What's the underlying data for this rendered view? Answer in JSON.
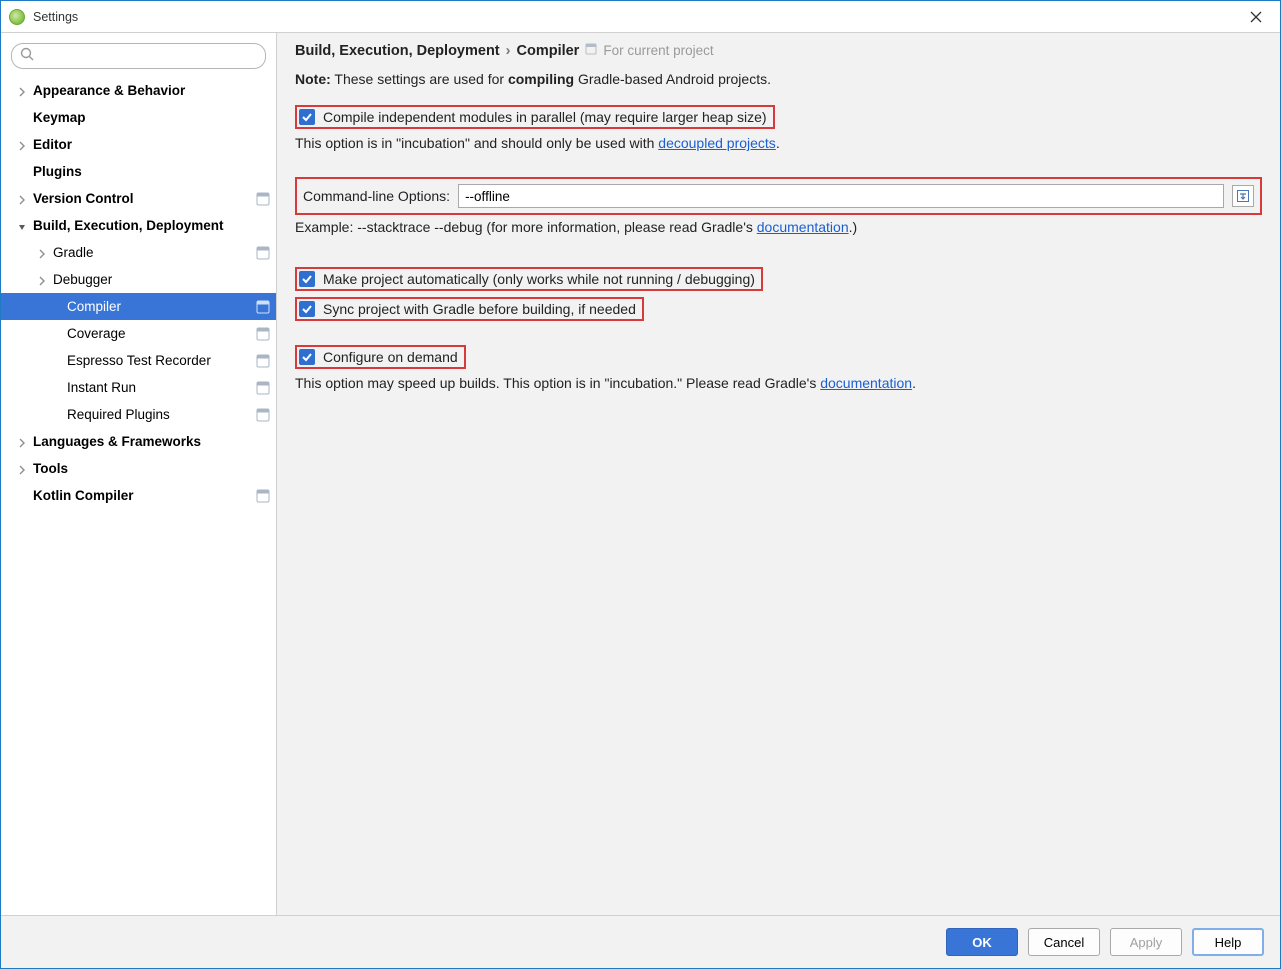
{
  "window": {
    "title": "Settings"
  },
  "sidebar": {
    "search_placeholder": "",
    "items": [
      {
        "label": "Appearance & Behavior",
        "depth": 0,
        "bold": true,
        "expander": "closed"
      },
      {
        "label": "Keymap",
        "depth": 0,
        "bold": true
      },
      {
        "label": "Editor",
        "depth": 0,
        "bold": true,
        "expander": "closed"
      },
      {
        "label": "Plugins",
        "depth": 0,
        "bold": true
      },
      {
        "label": "Version Control",
        "depth": 0,
        "bold": true,
        "expander": "closed",
        "badge": true
      },
      {
        "label": "Build, Execution, Deployment",
        "depth": 0,
        "bold": true,
        "expander": "open"
      },
      {
        "label": "Gradle",
        "depth": 1,
        "expander": "closed",
        "badge": true
      },
      {
        "label": "Debugger",
        "depth": 1,
        "expander": "closed"
      },
      {
        "label": "Compiler",
        "depth": 2,
        "badge": true,
        "selected": true
      },
      {
        "label": "Coverage",
        "depth": 2,
        "badge": true
      },
      {
        "label": "Espresso Test Recorder",
        "depth": 2,
        "badge": true
      },
      {
        "label": "Instant Run",
        "depth": 2,
        "badge": true
      },
      {
        "label": "Required Plugins",
        "depth": 2,
        "badge": true
      },
      {
        "label": "Languages & Frameworks",
        "depth": 0,
        "bold": true,
        "expander": "closed"
      },
      {
        "label": "Tools",
        "depth": 0,
        "bold": true,
        "expander": "closed"
      },
      {
        "label": "Kotlin Compiler",
        "depth": 0,
        "bold": true,
        "badge": true
      }
    ]
  },
  "breadcrumb": {
    "parent": "Build, Execution, Deployment",
    "sep": "›",
    "current": "Compiler",
    "sub": "For current project"
  },
  "note": {
    "prefix": "Note:",
    "mid1": " These settings are used for ",
    "strong": "compiling",
    "mid2": " Gradle-based Android projects."
  },
  "options": {
    "parallel": "Compile independent modules in parallel (may require larger heap size)",
    "parallel_hint_pre": "This option is in \"incubation\" and should only be used with ",
    "parallel_link": "decoupled projects",
    "parallel_hint_post": ".",
    "cmd_label": "Command-line Options:",
    "cmd_value": "--offline",
    "cmd_example_pre": "Example: --stacktrace --debug (for more information, please read Gradle's ",
    "cmd_example_link": "documentation",
    "cmd_example_post": ".)",
    "make_auto": "Make project automatically (only works while not running / debugging)",
    "sync_gradle": "Sync project with Gradle before building, if needed",
    "configure_demand": "Configure on demand",
    "configure_hint_pre": "This option may speed up builds. This option is in \"incubation.\" Please read Gradle's ",
    "configure_hint_link": "documentation",
    "configure_hint_post": "."
  },
  "footer": {
    "ok": "OK",
    "cancel": "Cancel",
    "apply": "Apply",
    "help": "Help"
  }
}
